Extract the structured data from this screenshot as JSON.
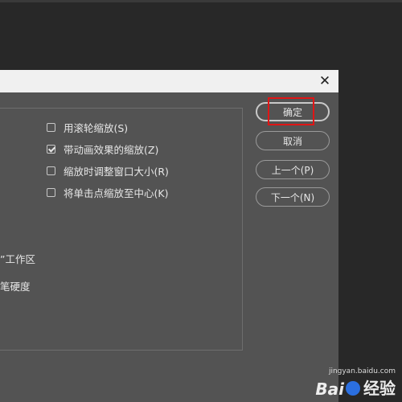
{
  "dialog": {
    "close_glyph": "✕",
    "checkboxes": [
      {
        "label": "用滚轮缩放(S)",
        "checked": false
      },
      {
        "label": "带动画效果的缩放(Z)",
        "checked": true
      },
      {
        "label": "缩放时调整窗口大小(R)",
        "checked": false
      },
      {
        "label": "将单击点缩放至中心(K)",
        "checked": false
      }
    ],
    "fragment_1": "”工作区",
    "fragment_2": "笔硬度"
  },
  "buttons": {
    "ok": "确定",
    "cancel": "取消",
    "prev": "上一个(P)",
    "next": "下一个(N)"
  },
  "watermark": {
    "logo": "Bai",
    "text": "经验",
    "url": "jingyan.baidu.com"
  },
  "colors": {
    "highlight": "#e01515",
    "dialog_bg": "#535353",
    "app_bg": "#282828"
  }
}
